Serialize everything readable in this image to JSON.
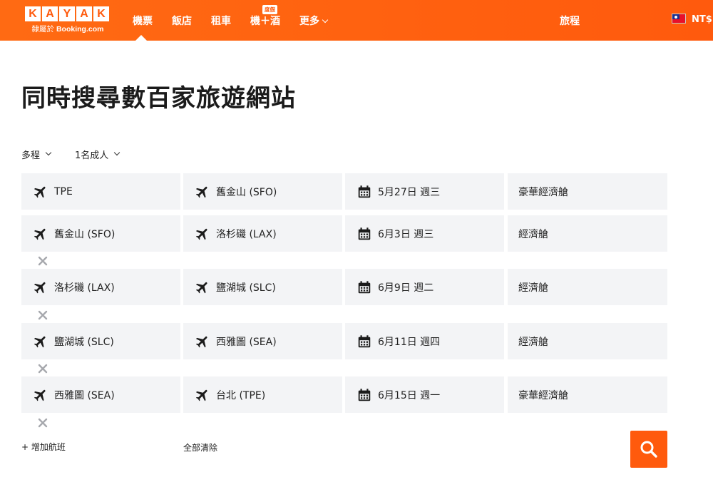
{
  "brand": {
    "logo_letters": [
      "K",
      "A",
      "Y",
      "A",
      "K"
    ],
    "logo_sub_prefix": "隸屬於",
    "logo_sub_brand": "Booking.com",
    "accent_color": "#ff5a0d"
  },
  "nav": {
    "flights": "機票",
    "hotels": "飯店",
    "cars": "租車",
    "packages": "機＋酒",
    "packages_badge": "度假",
    "more": "更多",
    "trips": "旅程",
    "currency": "NT$",
    "flag_icon": "taiwan-flag"
  },
  "main": {
    "title": "同時搜尋數百家旅遊網站",
    "trip_type": "多程",
    "travelers": "1名成人",
    "flights": [
      {
        "origin": "TPE",
        "destination": "舊金山 (SFO)",
        "date": "5月27日 週三",
        "cabin": "豪華經濟艙"
      },
      {
        "origin": "舊金山 (SFO)",
        "destination": "洛杉磯 (LAX)",
        "date": "6月3日 週三",
        "cabin": "經濟艙"
      },
      {
        "origin": "洛杉磯 (LAX)",
        "destination": "鹽湖城 (SLC)",
        "date": "6月9日 週二",
        "cabin": "經濟艙"
      },
      {
        "origin": "鹽湖城 (SLC)",
        "destination": "西雅圖 (SEA)",
        "date": "6月11日 週四",
        "cabin": "經濟艙"
      },
      {
        "origin": "西雅圖 (SEA)",
        "destination": "台北 (TPE)",
        "date": "6月15日 週一",
        "cabin": "豪華經濟艙"
      }
    ],
    "add_flight": "+ 增加航班",
    "clear_all": "全部清除",
    "search_icon": "search-icon"
  }
}
